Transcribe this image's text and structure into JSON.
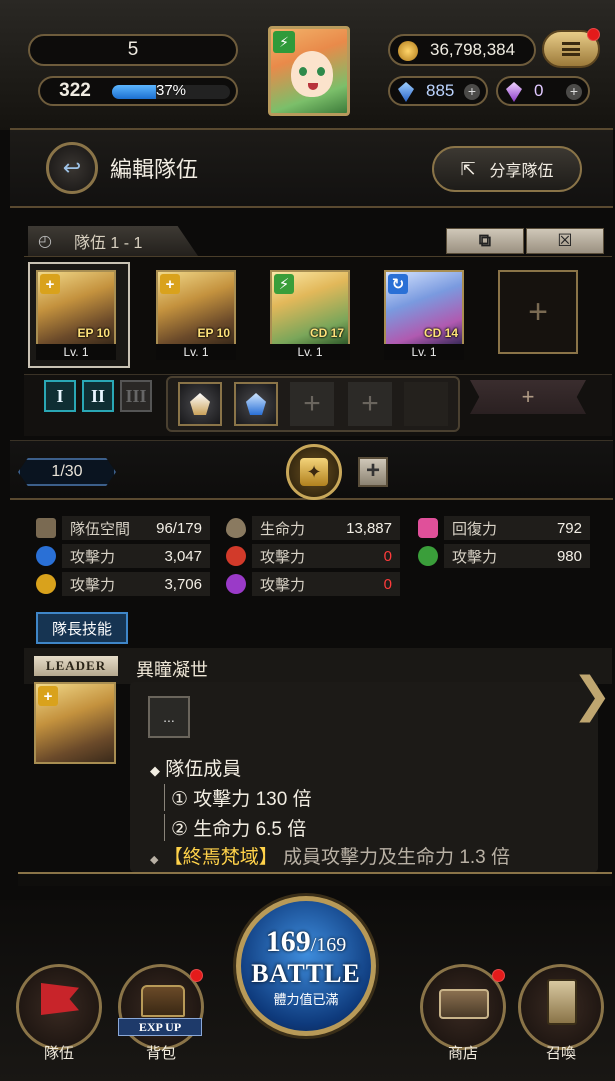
{
  "topbar": {
    "rank": "5",
    "level": "322",
    "exp_percent_text": "37%",
    "exp_fraction": 0.37,
    "coins": "36,798,384",
    "gems_blue": "885",
    "gems_purple": "0",
    "menu_icon": "hamburger-icon"
  },
  "header": {
    "title": "編輯隊伍",
    "share_label": "分享隊伍"
  },
  "team": {
    "tab_label": "隊伍 1 - 1",
    "copy_icon": "copy-icon",
    "close_icon": "close-icon",
    "cards": [
      {
        "cd": "EP 10",
        "lv": "Lv. 1",
        "attr": "light",
        "badge": "+"
      },
      {
        "cd": "EP 10",
        "lv": "Lv. 1",
        "attr": "light",
        "badge": "+"
      },
      {
        "cd": "CD 17",
        "lv": "Lv. 1",
        "attr": "wood",
        "badge": "⚡"
      },
      {
        "cd": "CD 14",
        "lv": "Lv. 1",
        "attr": "water",
        "badge": "↻"
      }
    ],
    "roman": [
      "I",
      "II",
      "III"
    ],
    "page": "1/30"
  },
  "stats": {
    "space_label": "隊伍空間",
    "space_value": "96/179",
    "hp_label": "生命力",
    "hp_value": "13,887",
    "recover_label": "回復力",
    "recover_value": "792",
    "atk_water_label": "攻擊力",
    "atk_water_value": "3,047",
    "atk_fire_label": "攻擊力",
    "atk_fire_value": "0",
    "atk_wood_label": "攻擊力",
    "atk_wood_value": "980",
    "atk_light_label": "攻擊力",
    "atk_light_value": "3,706",
    "atk_dark_label": "攻擊力",
    "atk_dark_value": "0"
  },
  "leader": {
    "tab": "隊長技能",
    "label": "LEADER",
    "skill_name": "異瞳凝世",
    "more": "...",
    "line1": "隊伍成員",
    "line2": "① 攻擊力 130 倍",
    "line3": "② 生命力 6.5 倍",
    "line4_hl": "【終焉梵域】",
    "line4_rest": "成員攻擊力及生命力 1.3 倍"
  },
  "nav": {
    "team": "隊伍",
    "bag": "背包",
    "expup": "EXP UP",
    "stamina_current": "169",
    "stamina_max": "169",
    "battle": "BATTLE",
    "battle_sub": "體力值已滿",
    "shop": "商店",
    "summon": "召喚"
  },
  "colors": {
    "gold": "#8a7448",
    "light": "#d9a21c",
    "wood": "#3a9e3a",
    "water": "#2a70d6",
    "fire": "#d23a2a",
    "dark": "#9a3ac8",
    "heart": "#e0509a"
  }
}
